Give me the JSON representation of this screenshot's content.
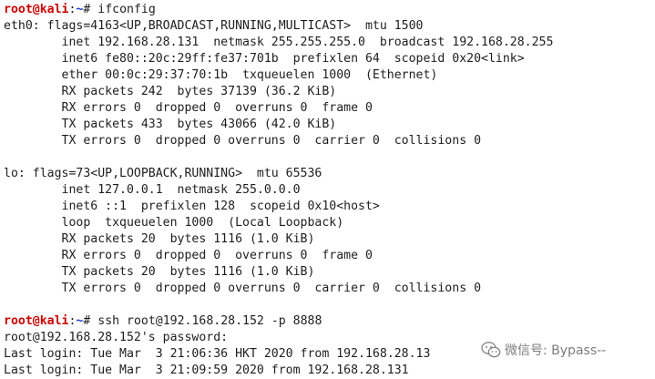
{
  "terminal": {
    "prompt_user": "root@kali",
    "prompt_sep": ":",
    "prompt_path": "~",
    "prompt_symbol": "# ",
    "commands": {
      "ifconfig": "ifconfig",
      "ssh": "ssh root@192.168.28.152 -p 8888"
    },
    "ifconfig_output": [
      "eth0: flags=4163<UP,BROADCAST,RUNNING,MULTICAST>  mtu 1500",
      "        inet 192.168.28.131  netmask 255.255.255.0  broadcast 192.168.28.255",
      "        inet6 fe80::20c:29ff:fe37:701b  prefixlen 64  scopeid 0x20<link>",
      "        ether 00:0c:29:37:70:1b  txqueuelen 1000  (Ethernet)",
      "        RX packets 242  bytes 37139 (36.2 KiB)",
      "        RX errors 0  dropped 0  overruns 0  frame 0",
      "        TX packets 433  bytes 43066 (42.0 KiB)",
      "        TX errors 0  dropped 0 overruns 0  carrier 0  collisions 0",
      "",
      "lo: flags=73<UP,LOOPBACK,RUNNING>  mtu 65536",
      "        inet 127.0.0.1  netmask 255.0.0.0",
      "        inet6 ::1  prefixlen 128  scopeid 0x10<host>",
      "        loop  txqueuelen 1000  (Local Loopback)",
      "        RX packets 20  bytes 1116 (1.0 KiB)",
      "        RX errors 0  dropped 0  overruns 0  frame 0",
      "        TX packets 20  bytes 1116 (1.0 KiB)",
      "        TX errors 0  dropped 0 overruns 0  carrier 0  collisions 0",
      ""
    ],
    "ssh_output": [
      "root@192.168.28.152's password:",
      "Last login: Tue Mar  3 21:06:36 HKT 2020 from 192.168.28.13",
      "Last login: Tue Mar  3 21:09:59 2020 from 192.168.28.131"
    ]
  },
  "watermark": {
    "icon": "wechat-icon",
    "text": "微信号: Bypass--"
  }
}
